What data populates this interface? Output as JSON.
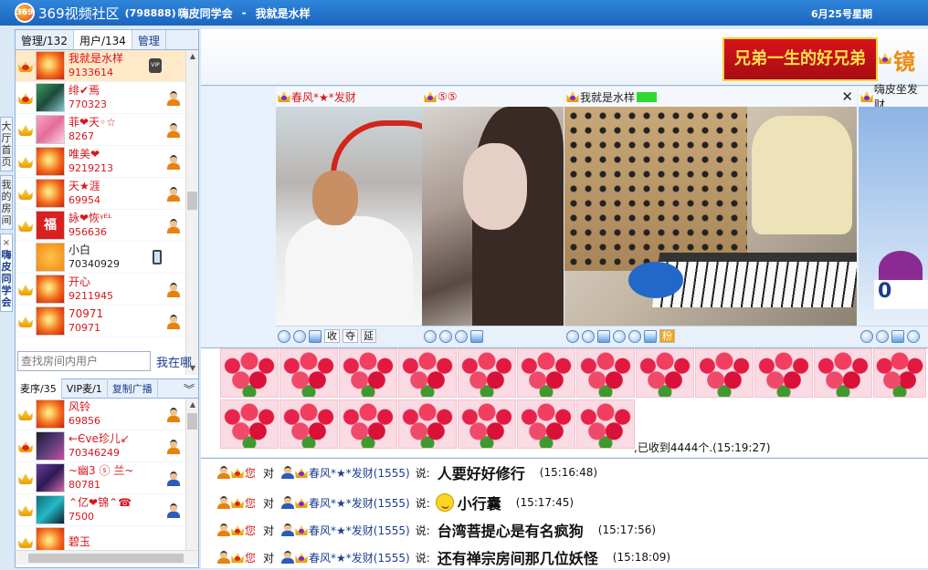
{
  "titlebar": {
    "logo": "369",
    "app_name": "369视频社区",
    "room_id": "(798888)",
    "room_name": "嗨皮同学会",
    "separator": "-",
    "current_user": "我就是水样",
    "date": "6月25号星期"
  },
  "vtabs": {
    "hall": "大厅首页",
    "my_rooms": "我的房间",
    "close": "×",
    "current_room": "嗨皮同学会"
  },
  "left": {
    "tabs": [
      "管理/132",
      "用户/134",
      "管理"
    ],
    "users": [
      {
        "name": "我就是水样",
        "id": "9133614"
      },
      {
        "name": "绯✔焉",
        "id": "770323"
      },
      {
        "name": "菲❤天◦☆",
        "id": "8267"
      },
      {
        "name": "唯美❤",
        "id": "9219213"
      },
      {
        "name": "天★涯",
        "id": "69954"
      },
      {
        "name": "詠❤恢ᵞᴱᴸ",
        "id": "956636"
      },
      {
        "name": "小白",
        "id": "70340929"
      },
      {
        "name": "开心",
        "id": "9211945"
      },
      {
        "name": "70971",
        "id": "70971"
      }
    ],
    "search_placeholder": "查找房间内用户",
    "where_button": "我在哪",
    "mic_tabs": [
      "麦序/35",
      "VIP麦/1",
      "复制广播"
    ],
    "mic_users": [
      {
        "name": "风铃",
        "id": "69856"
      },
      {
        "name": "←Єve珍儿↙",
        "id": "70346249"
      },
      {
        "name": "~幽3 ⓢ 兰~",
        "id": "80781"
      },
      {
        "name": "⌃亿❤锦⌃☎",
        "id": "7500"
      },
      {
        "name": "碧玉",
        "id": ""
      }
    ]
  },
  "banner": {
    "ad_text": "兄弟一生的好兄弟",
    "side_text": "镜"
  },
  "videos": [
    {
      "title": "春风*★*发财",
      "toolbar": [
        "收",
        "夺",
        "延"
      ]
    },
    {
      "title": "⑤⑤",
      "toolbar": []
    },
    {
      "title": "我就是水样",
      "toolbar": [
        "粉"
      ]
    },
    {
      "title": "嗨皮坐发财",
      "counter": "0",
      "toolbar": []
    }
  ],
  "gift": {
    "received_text": ",已收到4444个.(15:19:27)"
  },
  "chat": {
    "messages": [
      {
        "you": "您",
        "to": "对",
        "name": "春风*★*发财(1555)",
        "say": "说:",
        "msg": "人要好好修行",
        "time": "(15:16:48)"
      },
      {
        "you": "您",
        "to": "对",
        "name": "春风*★*发财(1555)",
        "say": "说:",
        "msg": "小行囊",
        "time": "(15:17:45)"
      },
      {
        "you": "您",
        "to": "对",
        "name": "春风*★*发财(1555)",
        "say": "说:",
        "msg": "台湾菩提心是有名疯狗",
        "time": "(15:17:56)"
      },
      {
        "you": "您",
        "to": "对",
        "name": "春风*★*发财(1555)",
        "say": "说:",
        "msg": "还有禅宗房间那几位妖怪",
        "time": "(15:18:09)"
      }
    ]
  }
}
